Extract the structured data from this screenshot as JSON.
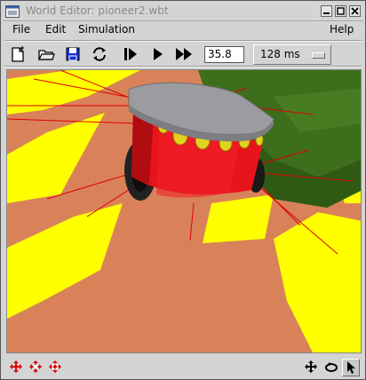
{
  "window": {
    "title": "World Editor: pioneer2.wbt",
    "controls": [
      "minimize-icon",
      "maximize-icon",
      "close-icon"
    ]
  },
  "menu": {
    "file": "File",
    "edit": "Edit",
    "simulation": "Simulation",
    "help": "Help"
  },
  "toolbar": {
    "icons": [
      "new-file-icon",
      "open-folder-icon",
      "save-icon",
      "revert-icon",
      "step-icon",
      "run-icon",
      "fast-forward-icon"
    ],
    "simulation_time": "35.8",
    "time_step": "128 ms"
  },
  "scene": {
    "subject": "pioneer2 robot on checkered floor",
    "colors": {
      "floor_light": "#ffff00",
      "floor_dark": "#d9825a",
      "robot_body": "#e8141c",
      "robot_top": "#9a9ca0",
      "sonar": "#e2d21e",
      "sensor_rays": "#e00000",
      "wall": "#3d6e1c"
    }
  },
  "status_bar": {
    "left_icons": [
      "translate-icon",
      "translate-xz-icon",
      "translate-y-icon"
    ],
    "right_icons": [
      "move-view-icon",
      "rotate-view-icon",
      "pointer-icon"
    ],
    "icon_color": "#e00000"
  }
}
